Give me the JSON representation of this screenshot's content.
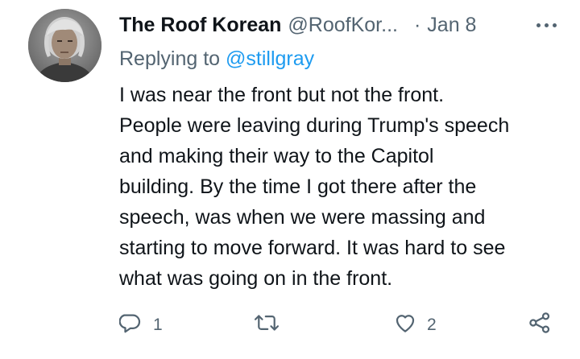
{
  "tweet": {
    "display_name": "The Roof Korean",
    "handle": "@RoofKor...",
    "separator": "·",
    "date": "Jan 8",
    "replying_prefix": "Replying to ",
    "replying_to": "@stillgray",
    "text": "I was near the front but not the front.\nPeople were leaving during Trump's speech\nand making their way to the Capitol\nbuilding. By the time I got there after the\nspeech, was when we were massing and\nstarting to move forward. It was hard to see\nwhat was going on in the front."
  },
  "actions": {
    "reply_count": "1",
    "like_count": "2"
  },
  "icons": {
    "more": "more-horizontal-icon",
    "reply": "comment-icon",
    "retweet": "retweet-icon",
    "like": "heart-icon",
    "share": "share-icon"
  },
  "colors": {
    "text": "#0f1419",
    "secondary": "#536471",
    "link": "#1d9bf0",
    "background": "#ffffff"
  }
}
